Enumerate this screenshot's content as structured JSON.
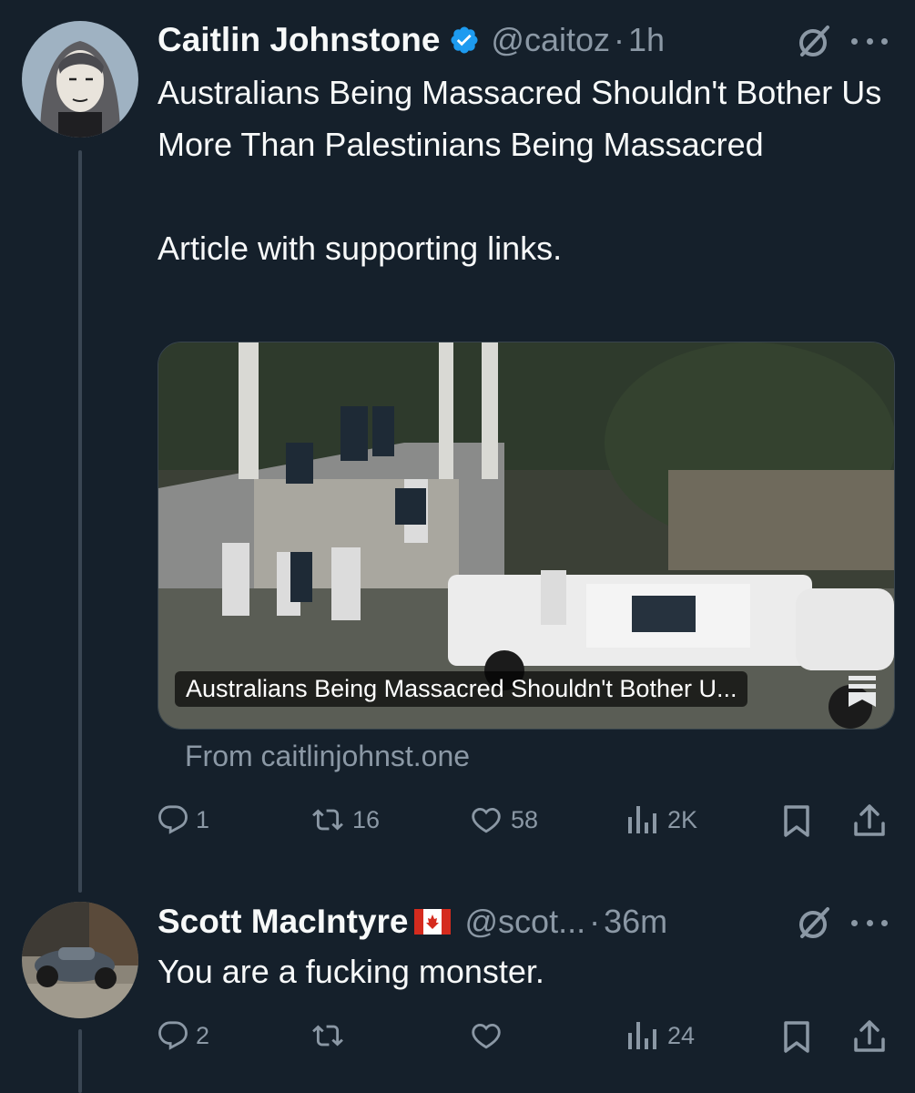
{
  "colors": {
    "background": "#15202b",
    "text": "#f7f9f9",
    "secondary": "#8b98a5",
    "verified": "#1d9bf0",
    "thread_line": "#3a4653"
  },
  "tweet1": {
    "name": "Caitlin Johnstone",
    "verified": "verified-badge-icon",
    "handle": "@caitoz",
    "dot": "·",
    "time": "1h",
    "text": "Australians Being Massacred Shouldn't Bother Us More Than Palestinians Being Massacred\n\nArticle with supporting links.",
    "card": {
      "caption": "Australians Being Massacred Shouldn't Bother U...",
      "from": "From caitlinjohnst.one"
    },
    "actions": {
      "reply": "1",
      "retweet": "16",
      "like": "58",
      "views": "2K"
    }
  },
  "tweet2": {
    "name": "Scott MacIntyre",
    "flag": "canada-flag-emoji",
    "handle": "@scot...",
    "dot": "·",
    "time": "36m",
    "text": "You are a fucking monster.",
    "actions": {
      "reply": "2",
      "retweet": "",
      "like": "",
      "views": "24"
    }
  }
}
